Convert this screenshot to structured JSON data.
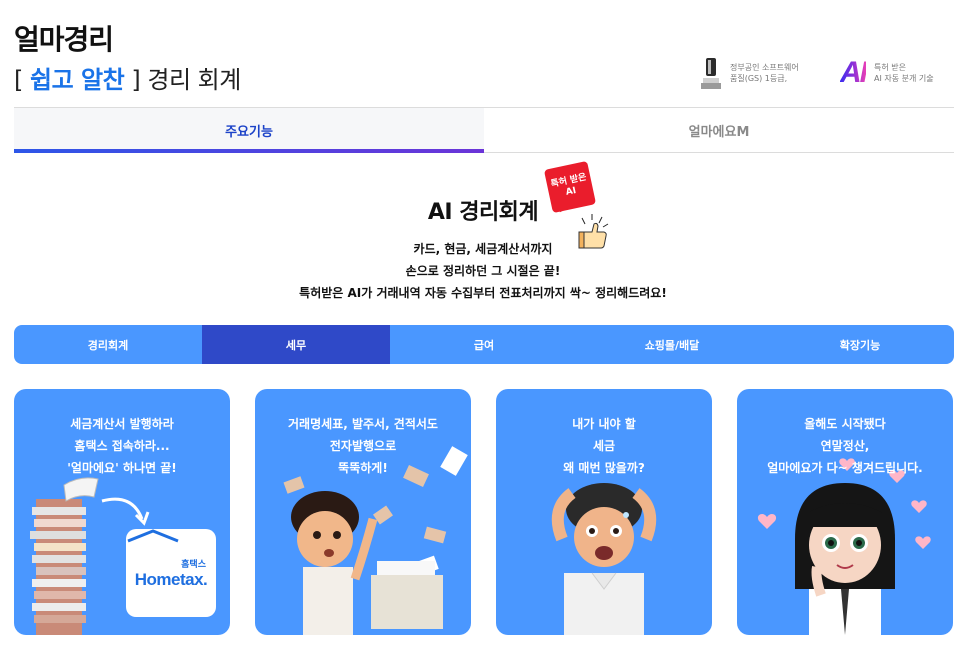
{
  "brand": {
    "logo": "얼마경리",
    "tagline_open": "[",
    "tagline_accent": "쉽고 알찬",
    "tagline_close": "]",
    "tagline_rest": "경리 회계"
  },
  "certs": {
    "gs_line1": "정부공인 소프트웨어",
    "gs_line2": "품질(GS) 1등급,",
    "ai_mark": "AI",
    "ai_line1": "특허 받은",
    "ai_line2": "AI 자동 분개 기술"
  },
  "tabs": [
    {
      "label": "주요기능",
      "active": true
    },
    {
      "label": "얼마에요M",
      "active": false
    }
  ],
  "hero": {
    "badge_line1": "특허 받은",
    "badge_line2": "AI",
    "title": "AI 경리회계",
    "line1": "카드, 현금, 세금계산서까지",
    "line2": "손으로 정리하던 그 시절은 끝!",
    "line3": "특허받은 AI가 거래내역 자동 수집부터 전표처리까지 싹~ 정리해드려요!"
  },
  "subtabs": [
    {
      "label": "경리회계",
      "active": false
    },
    {
      "label": "세무",
      "active": true
    },
    {
      "label": "급여",
      "active": false
    },
    {
      "label": "쇼핑몰/배달",
      "active": false
    },
    {
      "label": "확장기능",
      "active": false
    }
  ],
  "cards": [
    {
      "lines": [
        "세금계산서 발행하라",
        "홈택스 접속하라...",
        "'얼마에요' 하나면 끝!"
      ],
      "hometax_ko": "홈택스",
      "hometax_en": "Hometax."
    },
    {
      "lines": [
        "거래명세표, 발주서, 견적서도",
        "전자발행으로",
        "뚝뚝하게!"
      ]
    },
    {
      "lines": [
        "내가 내야 할",
        "세금",
        "왜 매번 많을까?"
      ]
    },
    {
      "lines": [
        "올해도 시작됐다",
        "연말정산,",
        "얼마에요가 다~ 챙겨드립니다."
      ]
    }
  ],
  "colors": {
    "accent_blue": "#1a73e8",
    "tab_active": "#1c43c8",
    "bar_blue": "#4a97ff",
    "bar_active": "#2f49c8",
    "badge_red": "#ea1d2c"
  },
  "icons": {
    "gs": "gs-trophy-icon",
    "ai": "ai-logo-icon",
    "thumb": "thumbs-up-icon"
  }
}
